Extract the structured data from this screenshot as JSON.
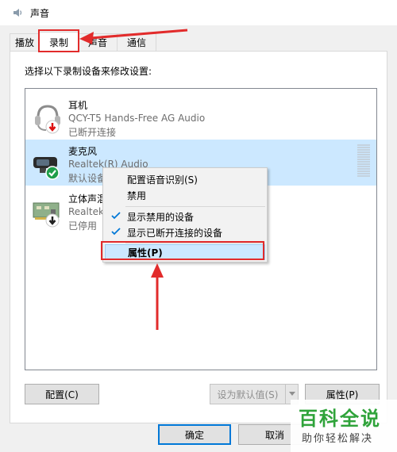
{
  "window": {
    "title": "声音"
  },
  "tabs": [
    {
      "label": "播放"
    },
    {
      "label": "录制"
    },
    {
      "label": "声音"
    },
    {
      "label": "通信"
    }
  ],
  "instruction": "选择以下录制设备来修改设置:",
  "devices": [
    {
      "name": "耳机",
      "description": "QCY-T5 Hands-Free AG Audio",
      "status": "已断开连接",
      "icon": "headset-icon",
      "badge": "disconnected-down-arrow-icon"
    },
    {
      "name": "麦克风",
      "description": "Realtek(R) Audio",
      "status": "默认设备",
      "icon": "microphone-icon",
      "badge": "default-check-icon",
      "selected": true
    },
    {
      "name": "立体声混",
      "description": "Realtek",
      "status": "已停用",
      "icon": "sound-card-icon",
      "badge": "disabled-down-arrow-icon"
    }
  ],
  "context_menu": {
    "items": [
      {
        "label": "配置语音识别(S)",
        "checked": false
      },
      {
        "label": "禁用",
        "checked": false
      },
      {
        "label": "显示禁用的设备",
        "checked": true
      },
      {
        "label": "显示已断开连接的设备",
        "checked": true
      },
      {
        "label": "属性(P)",
        "checked": false,
        "highlighted": true
      }
    ]
  },
  "buttons": {
    "configure": "配置(C)",
    "set_default": "设为默认值(S)",
    "properties": "属性(P)",
    "ok": "确定",
    "cancel": "取消"
  },
  "watermark": {
    "main": "百科全说",
    "sub": "助你轻松解决"
  },
  "colors": {
    "accent": "#0078d7",
    "annotation": "#e22b2b",
    "selection": "#cce8ff",
    "watermark": "#2fa33a"
  }
}
